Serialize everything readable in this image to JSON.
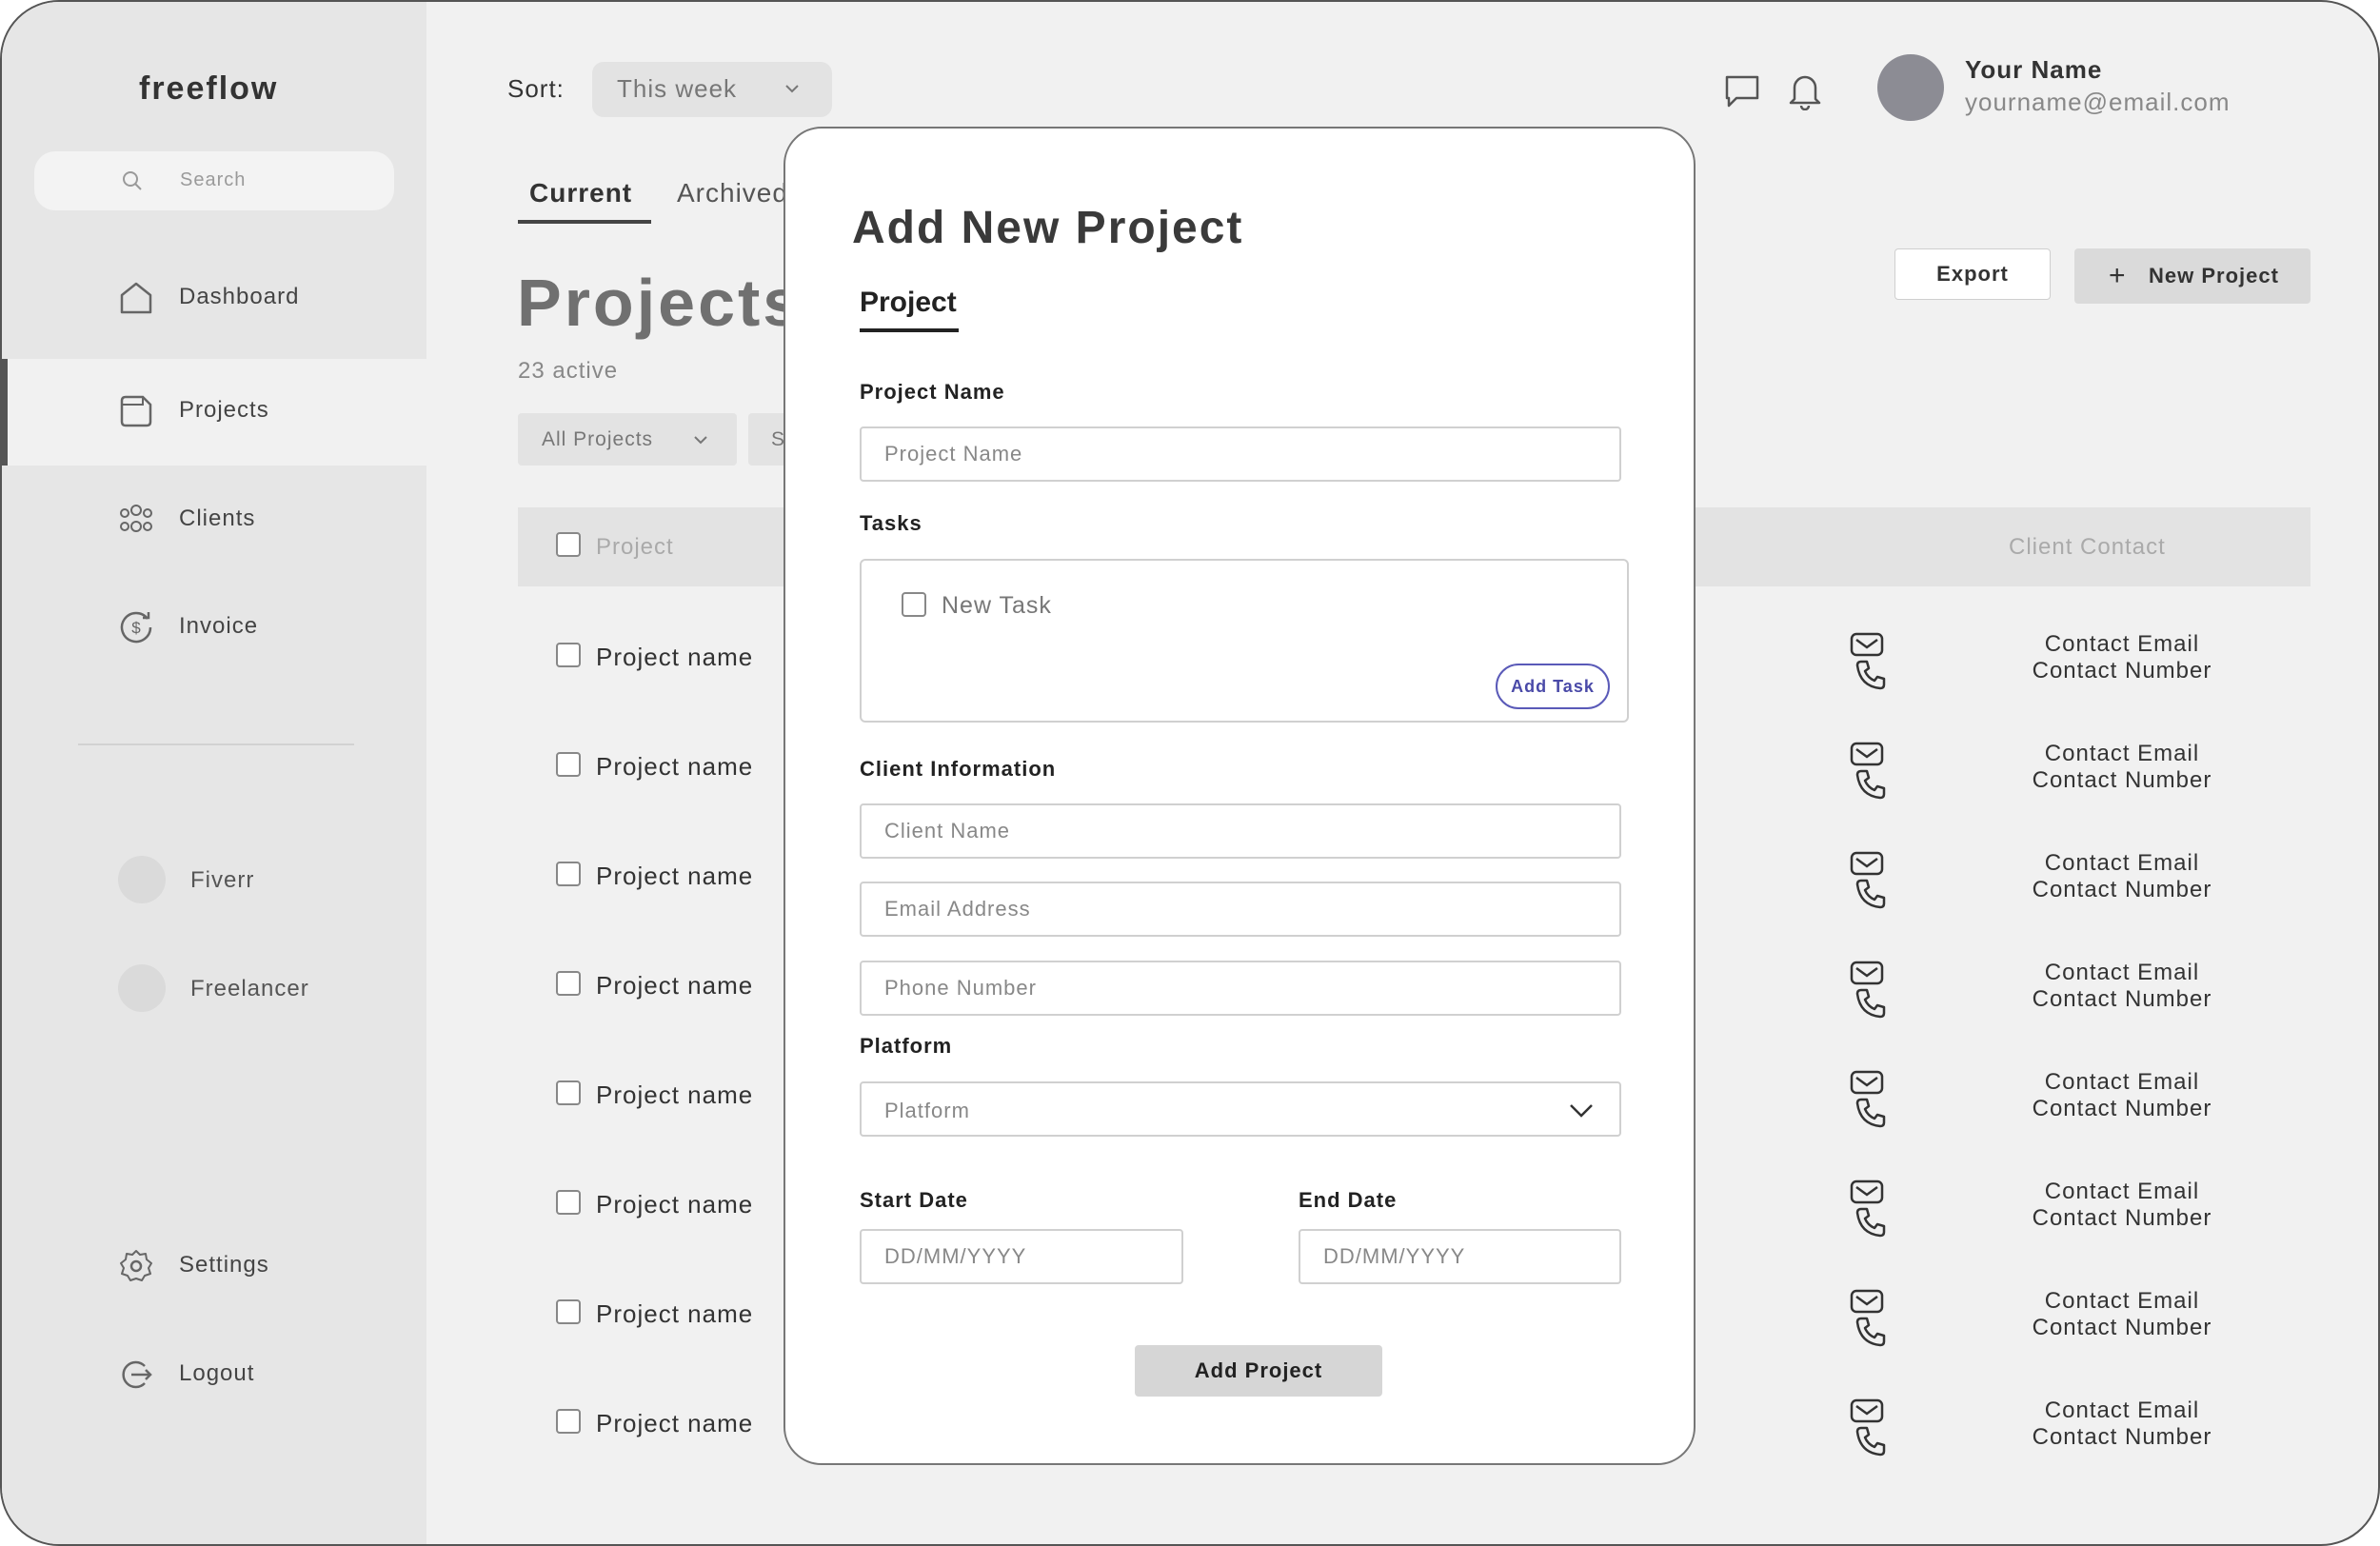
{
  "app": {
    "logo": "freeflow"
  },
  "sidebar": {
    "search_placeholder": "Search",
    "nav": [
      {
        "label": "Dashboard",
        "icon": "home-icon"
      },
      {
        "label": "Projects",
        "icon": "folder-icon",
        "active": true
      },
      {
        "label": "Clients",
        "icon": "users-icon"
      },
      {
        "label": "Invoice",
        "icon": "dollar-refresh-icon"
      }
    ],
    "platforms": [
      {
        "label": "Fiverr"
      },
      {
        "label": "Freelancer"
      }
    ],
    "bottom": [
      {
        "label": "Settings",
        "icon": "gear-icon"
      },
      {
        "label": "Logout",
        "icon": "logout-icon"
      }
    ]
  },
  "header": {
    "sort_label": "Sort:",
    "sort_value": "This week",
    "user_name": "Your Name",
    "user_email": "yourname@email.com"
  },
  "main": {
    "tabs": [
      {
        "label": "Current",
        "active": true
      },
      {
        "label": "Archived"
      }
    ],
    "title": "Projects",
    "active_count": "23 active",
    "filter_all": "All Projects",
    "filter_second": "S",
    "export_label": "Export",
    "new_project_label": "New Project",
    "table": {
      "col_project": "Project",
      "col_contact": "Client Contact",
      "rows": [
        {
          "name": "Project name",
          "email": "Contact Email",
          "number": "Contact Number"
        },
        {
          "name": "Project name",
          "email": "Contact Email",
          "number": "Contact Number"
        },
        {
          "name": "Project name",
          "email": "Contact Email",
          "number": "Contact Number"
        },
        {
          "name": "Project name",
          "email": "Contact Email",
          "number": "Contact Number"
        },
        {
          "name": "Project name",
          "email": "Contact Email",
          "number": "Contact Number"
        },
        {
          "name": "Project name",
          "email": "Contact Email",
          "number": "Contact Number"
        },
        {
          "name": "Project name",
          "email": "Contact Email",
          "number": "Contact Number"
        },
        {
          "name": "Project name",
          "email": "Contact Email",
          "number": "Contact Number"
        }
      ]
    }
  },
  "modal": {
    "title": "Add New Project",
    "tab": "Project",
    "project_name_label": "Project Name",
    "project_name_placeholder": "Project Name",
    "tasks_label": "Tasks",
    "new_task": "New Task",
    "add_task": "Add Task",
    "client_info_label": "Client Information",
    "client_name_placeholder": "Client Name",
    "email_placeholder": "Email Address",
    "phone_placeholder": "Phone Number",
    "platform_label": "Platform",
    "platform_value": "Platform",
    "start_date_label": "Start Date",
    "end_date_label": "End Date",
    "date_placeholder": "DD/MM/YYYY",
    "submit": "Add Project"
  },
  "colors": {
    "sidebar_bg": "#e6e6e6",
    "main_bg": "#f1f1f1",
    "accent_button": "#4a4aa8"
  }
}
